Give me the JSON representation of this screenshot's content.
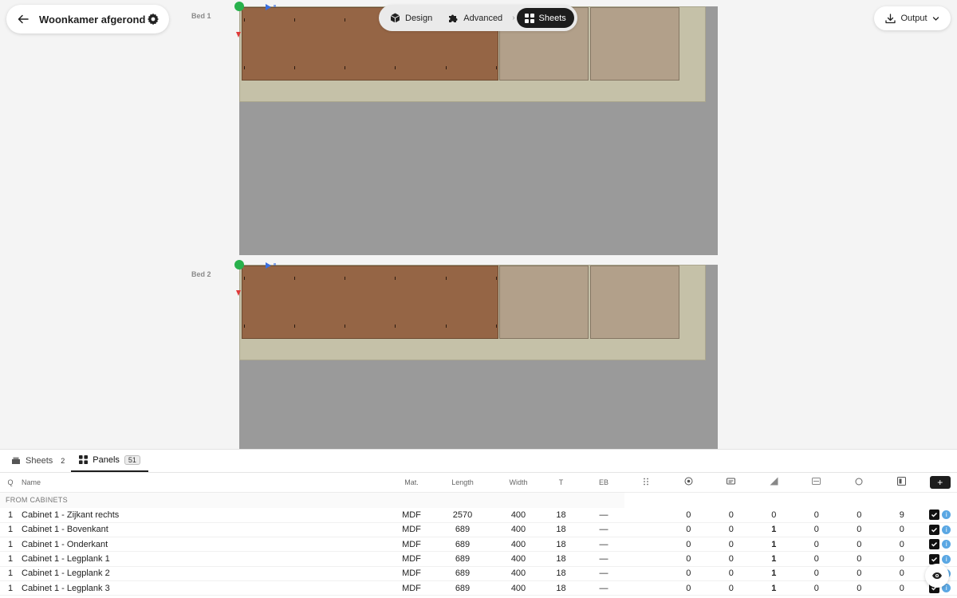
{
  "header": {
    "title": "Woonkamer afgerond"
  },
  "modes": [
    {
      "label": "Design",
      "icon": "cube-icon"
    },
    {
      "label": "Advanced",
      "icon": "puzzle-icon"
    },
    {
      "label": "Sheets",
      "icon": "grid-icon",
      "active": true
    }
  ],
  "output": {
    "label": "Output"
  },
  "beds": [
    {
      "label": "Bed 1"
    },
    {
      "label": "Bed 2"
    }
  ],
  "tabs": [
    {
      "label": "Sheets",
      "count": "2",
      "icon": "sheets-icon"
    },
    {
      "label": "Panels",
      "count": "51",
      "icon": "grid-icon",
      "active": true
    }
  ],
  "table": {
    "headers": {
      "q": "Q",
      "name": "Name",
      "mat": "Mat.",
      "length": "Length",
      "width": "Width",
      "t": "T",
      "eb": "EB"
    },
    "icon_columns": [
      "drill-holes-icon",
      "target-icon",
      "card-icon",
      "corner-icon",
      "groove-icon",
      "circle-icon",
      "split-icon"
    ],
    "group": "FROM CABINETS",
    "rows": [
      {
        "q": "1",
        "name": "Cabinet 1 - Zijkant rechts",
        "mat": "MDF",
        "length": "2570",
        "width": "400",
        "t": "18",
        "eb": "—",
        "vals": [
          "0",
          "0",
          "0",
          "0",
          "0",
          "9"
        ]
      },
      {
        "q": "1",
        "name": "Cabinet 1 - Bovenkant",
        "mat": "MDF",
        "length": "689",
        "width": "400",
        "t": "18",
        "eb": "—",
        "vals": [
          "0",
          "0",
          "1",
          "0",
          "0",
          "0"
        ]
      },
      {
        "q": "1",
        "name": "Cabinet 1 - Onderkant",
        "mat": "MDF",
        "length": "689",
        "width": "400",
        "t": "18",
        "eb": "—",
        "vals": [
          "0",
          "0",
          "1",
          "0",
          "0",
          "0"
        ]
      },
      {
        "q": "1",
        "name": "Cabinet 1 - Legplank 1",
        "mat": "MDF",
        "length": "689",
        "width": "400",
        "t": "18",
        "eb": "—",
        "vals": [
          "0",
          "0",
          "1",
          "0",
          "0",
          "0"
        ]
      },
      {
        "q": "1",
        "name": "Cabinet 1 - Legplank 2",
        "mat": "MDF",
        "length": "689",
        "width": "400",
        "t": "18",
        "eb": "—",
        "vals": [
          "0",
          "0",
          "1",
          "0",
          "0",
          "0"
        ]
      },
      {
        "q": "1",
        "name": "Cabinet 1 - Legplank 3",
        "mat": "MDF",
        "length": "689",
        "width": "400",
        "t": "18",
        "eb": "—",
        "vals": [
          "0",
          "0",
          "1",
          "0",
          "0",
          "0"
        ]
      }
    ]
  },
  "colors": {
    "accent": "#1d1d1d",
    "panel_brown": "#956545",
    "panel_tan": "#b2a08a",
    "sheet_board": "#c5c1a8",
    "bed_bg": "#9a9a9a",
    "highlight_value": "#e09a1a",
    "info": "#5aa7e3",
    "origin": "#28b14c"
  }
}
